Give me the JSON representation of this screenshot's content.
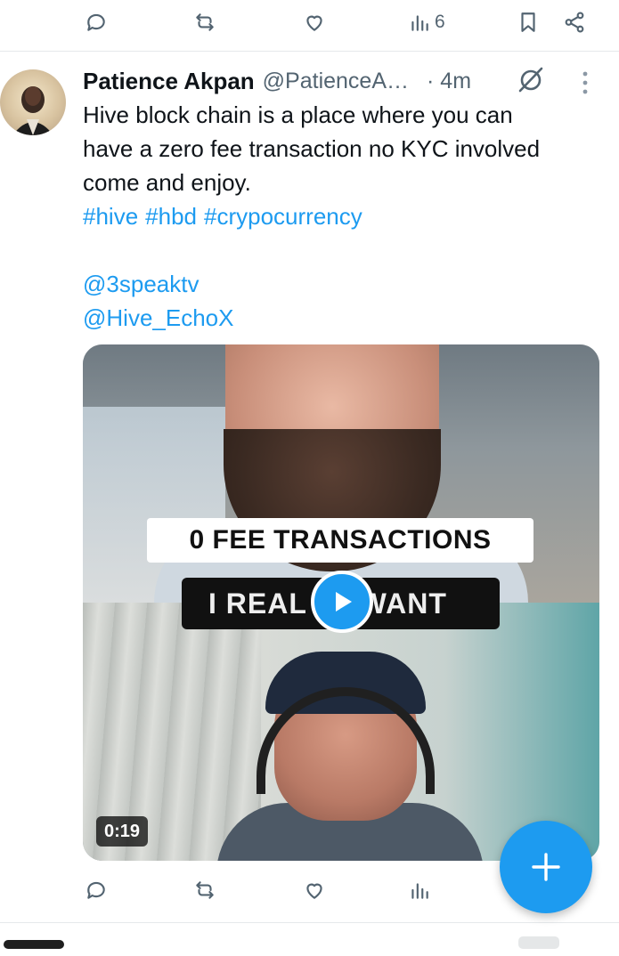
{
  "previous_tweet_actions": {
    "reply_icon": "reply-icon",
    "retweet_icon": "retweet-icon",
    "like_icon": "like-icon",
    "views_count": "6",
    "bookmark_icon": "bookmark-icon",
    "share_icon": "share-icon"
  },
  "tweet": {
    "author_name": "Patience Akpan",
    "author_handle": "@PatienceA…",
    "time": "· 4m",
    "text_lines": [
      "Hive block chain is a place where you can",
      "have a zero fee transaction no KYC involved",
      "come and enjoy."
    ],
    "hashtags": [
      "#hive",
      "#hbd",
      "#crypocurrency"
    ],
    "mentions": [
      "@3speaktv",
      "@Hive_EchoX"
    ],
    "media": {
      "caption_top": "0 FEE TRANSACTIONS",
      "caption_bottom": "I REAL      WANT",
      "duration": "0:19"
    }
  },
  "colors": {
    "accent": "#1d9bf0",
    "muted": "#536471",
    "text": "#0f1419",
    "divider": "#e6e9eb"
  },
  "fab": {
    "icon": "plus-icon"
  }
}
